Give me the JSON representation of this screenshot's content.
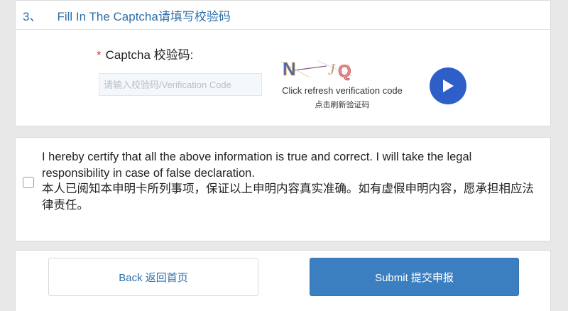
{
  "captcha_section": {
    "number": "3、",
    "title": "Fill In The Captcha请填写校验码",
    "required_mark": "*",
    "label": "Captcha 校验码:",
    "input_placeholder": "请输入校验码/Verification Code",
    "input_value": "",
    "captcha_text": "N‐JQ",
    "refresh_text_en": "Click refresh verification code",
    "refresh_text_zh": "点击刷新验证码",
    "play_icon": "play-icon",
    "play_color": "#2e5fc9"
  },
  "declaration": {
    "checked": false,
    "text_en": "I hereby certify that all the above information is true and correct. I will take the legal responsibility in case of false declaration.",
    "text_zh": "本人已阅知本申明卡所列事项，保证以上申明内容真实准确。如有虚假申明内容，愿承担相应法律责任。"
  },
  "actions": {
    "back_label": "Back 返回首页",
    "submit_label": "Submit 提交申报",
    "submit_color": "#3c7fc0"
  }
}
